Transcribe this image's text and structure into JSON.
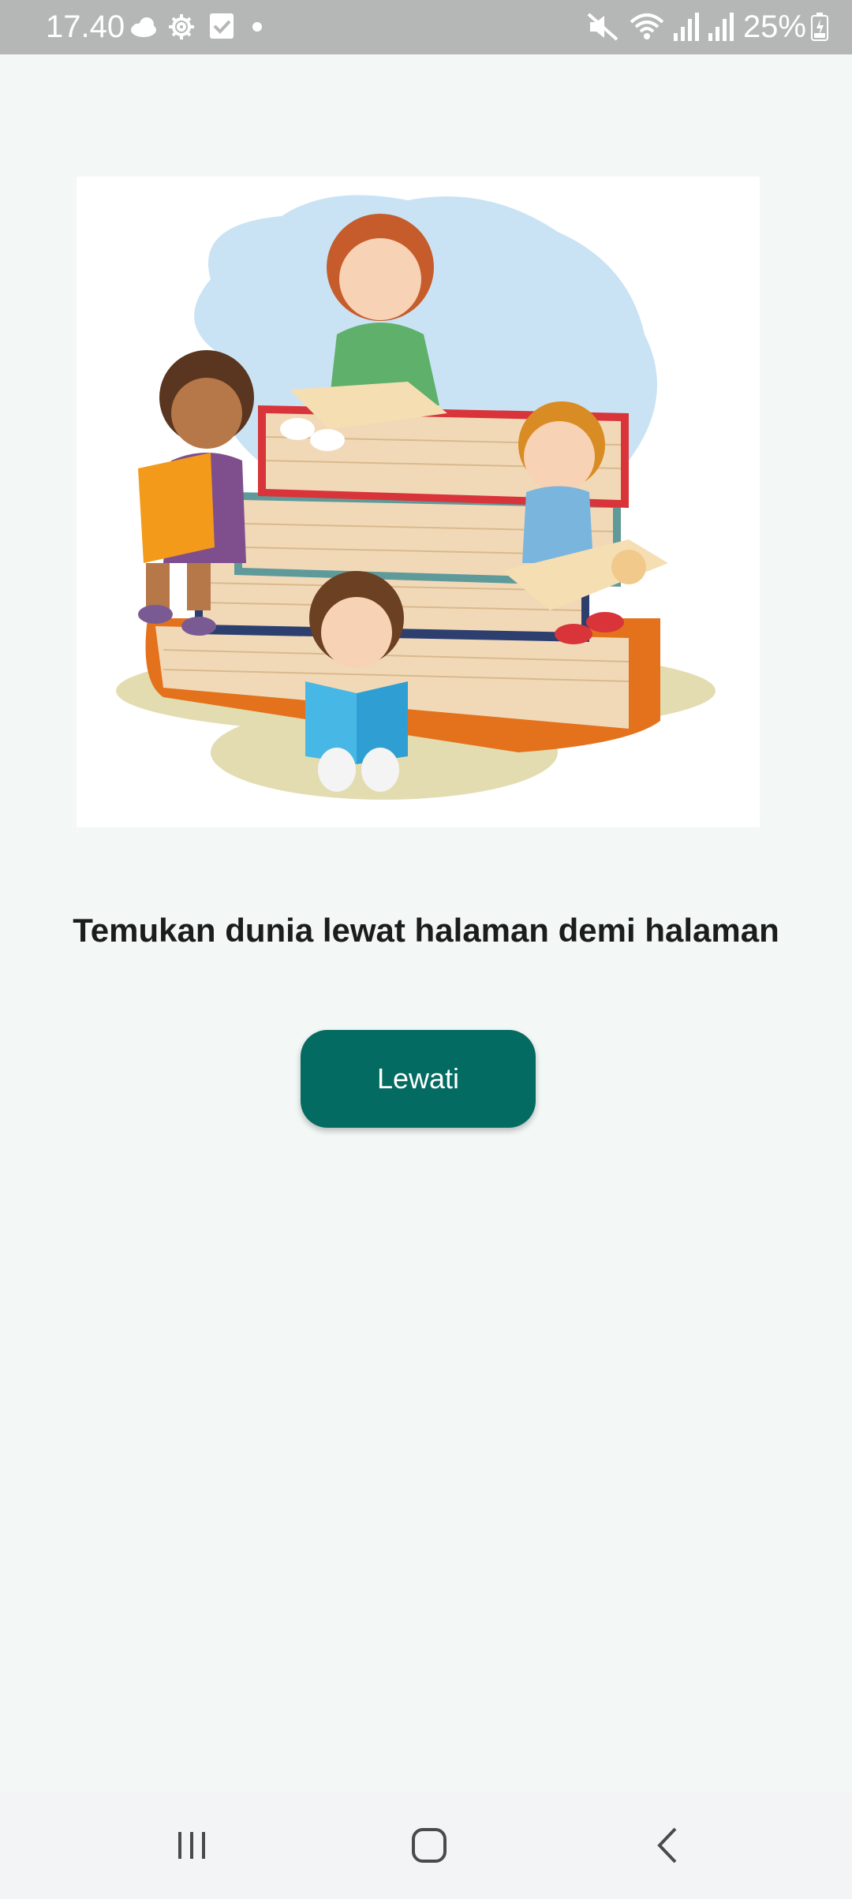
{
  "status_bar": {
    "time": "17.40",
    "battery_percent": "25%",
    "left_icons": [
      "cloud-icon",
      "gear-icon",
      "checkbox-icon",
      "dot-icon"
    ],
    "right_icons": [
      "mute-icon",
      "wifi-icon",
      "signal-icon",
      "signal-icon",
      "battery-icon"
    ]
  },
  "illustration": {
    "icon": "children-reading-books-illustration"
  },
  "headline": "Temukan dunia lewat halaman demi halaman",
  "skip_button": {
    "label": "Lewati",
    "color": "#036b61"
  },
  "nav_bar": {
    "icons": [
      "recent-apps-icon",
      "home-icon",
      "back-icon"
    ]
  },
  "colors": {
    "background": "#f3f8f6",
    "status_bar": "#b5b7b6",
    "accent": "#036b61"
  }
}
